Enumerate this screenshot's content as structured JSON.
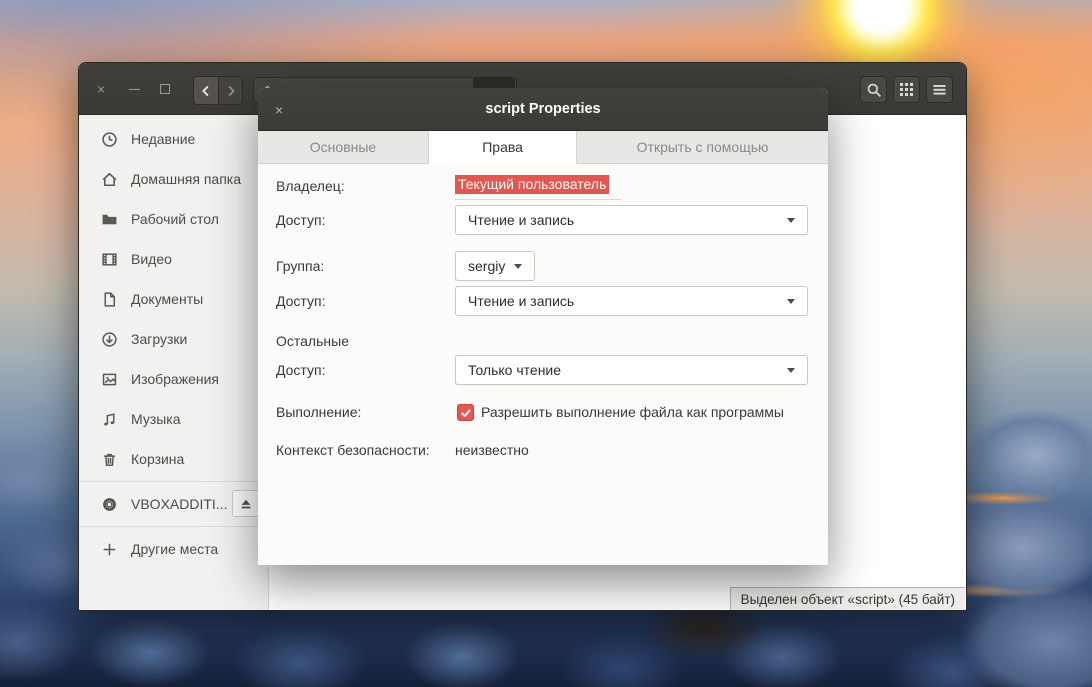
{
  "colors": {
    "accent": "#e4564f",
    "titlebar": "#3c3b37",
    "sidebar_bg": "#f2f1ef",
    "dialog_bg": "#fbfbfa"
  },
  "window": {
    "controls": {
      "close": "×",
      "minimize": "─",
      "maximize": ""
    },
    "status_text": "Выделен объект «script» (45 байт)",
    "sidebar": {
      "items": [
        {
          "icon": "clock-icon",
          "label": "Недавние"
        },
        {
          "icon": "home-icon",
          "label": "Домашняя папка"
        },
        {
          "icon": "folder-icon",
          "label": "Рабочий стол"
        },
        {
          "icon": "film-icon",
          "label": "Видео"
        },
        {
          "icon": "document-icon",
          "label": "Документы"
        },
        {
          "icon": "download-icon",
          "label": "Загрузки"
        },
        {
          "icon": "image-icon",
          "label": "Изображения"
        },
        {
          "icon": "music-icon",
          "label": "Музыка"
        },
        {
          "icon": "trash-icon",
          "label": "Корзина"
        }
      ],
      "device": {
        "icon": "disc-icon",
        "label": "VBOXADDITI...",
        "eject_icon": "eject-icon"
      },
      "other_places": {
        "icon": "plus-icon",
        "label": "Другие места"
      }
    }
  },
  "dialog": {
    "title": "script Properties",
    "close_glyph": "×",
    "tabs": [
      {
        "label": "Основные",
        "active": false
      },
      {
        "label": "Права",
        "active": true
      },
      {
        "label": "Открыть с помощью",
        "active": false
      }
    ],
    "permissions": {
      "owner_label": "Владелец:",
      "owner_value": "Текущий пользователь",
      "owner_access_label": "Доступ:",
      "owner_access_value": "Чтение и запись",
      "group_label": "Группа:",
      "group_value": "sergiy",
      "group_access_label": "Доступ:",
      "group_access_value": "Чтение и запись",
      "others_heading": "Остальные",
      "others_access_label": "Доступ:",
      "others_access_value": "Только чтение",
      "execute_label": "Выполнение:",
      "execute_checkbox_label": "Разрешить выполнение файла как программы",
      "execute_checked": true,
      "security_label": "Контекст безопасности:",
      "security_value": "неизвестно"
    }
  }
}
